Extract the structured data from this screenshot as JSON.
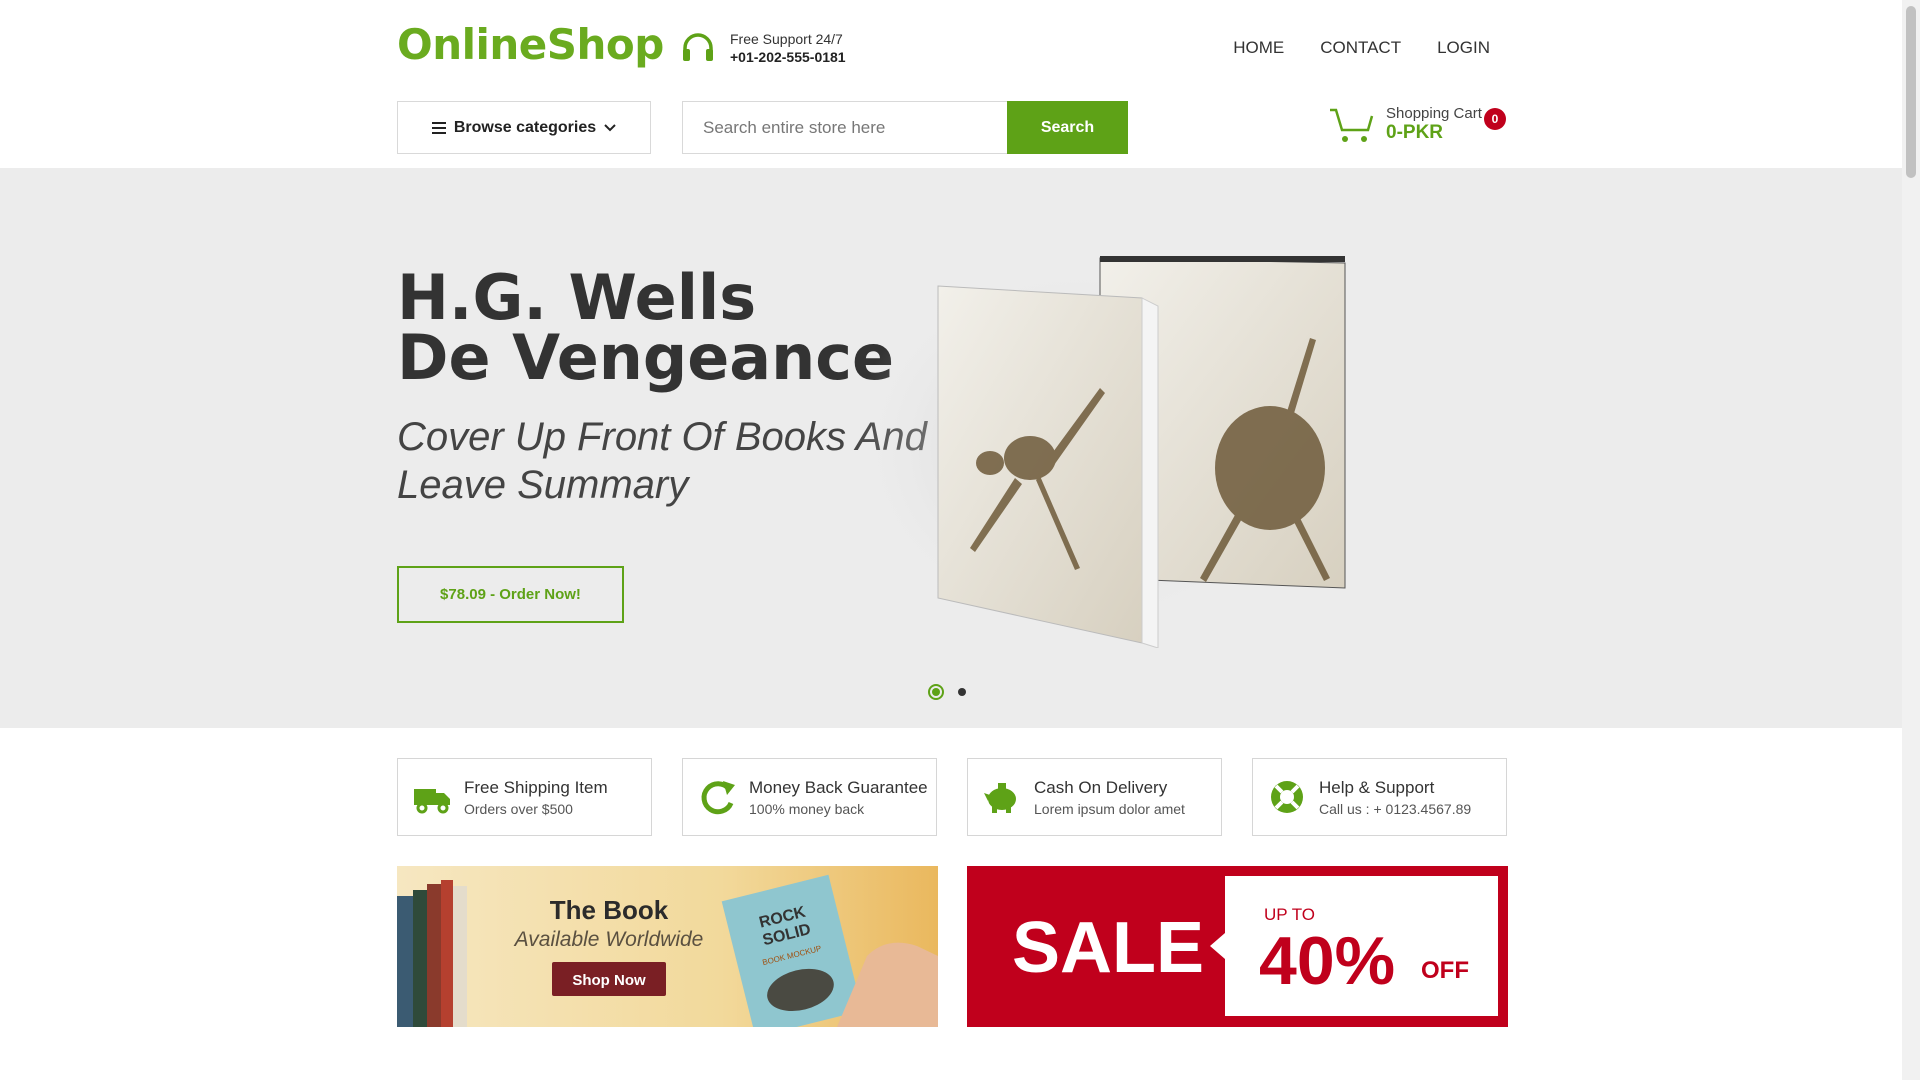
{
  "brand": {
    "logo": "OnlineShop",
    "accent": "#5ea217",
    "sale_red": "#c0001c"
  },
  "support": {
    "title": "Free Support 24/7",
    "phone": "+01-202-555-0181",
    "icon": "headphones-icon"
  },
  "nav": {
    "home": "HOME",
    "contact": "CONTACT",
    "login": "LOGIN"
  },
  "toolbar": {
    "browse_label": "Browse categories",
    "search_placeholder": "Search entire store here",
    "search_label": "Search"
  },
  "cart": {
    "label": "Shopping Cart",
    "total": "0-PKR",
    "count": "0"
  },
  "hero": {
    "title_line1": "H.G. Wells",
    "title_line2": "De Vengeance",
    "subtitle": "Cover Up Front Of Books And Leave Summary",
    "cta": "$78.09 - Order Now!",
    "slides": 2,
    "active_slide": 1
  },
  "features": [
    {
      "title": "Free Shipping Item",
      "sub": "Orders over $500",
      "icon": "truck-icon"
    },
    {
      "title": "Money Back Guarantee",
      "sub": "100% money back",
      "icon": "refresh-icon"
    },
    {
      "title": "Cash On Delivery",
      "sub": "Lorem ipsum dolor amet",
      "icon": "piggy-bank-icon"
    },
    {
      "title": "Help & Support",
      "sub": "Call us : + 0123.4567.89",
      "icon": "lifebuoy-icon"
    }
  ],
  "banners": {
    "book": {
      "title": "The Book",
      "sub": "Available Worldwide",
      "cta": "Shop Now",
      "mockup_text1": "ROCK",
      "mockup_text2": "SOLID",
      "mockup_text3": "BOOK MOCKUP"
    },
    "sale": {
      "label": "SALE",
      "up_to": "UP TO",
      "percent": "40%",
      "off": "OFF"
    }
  }
}
